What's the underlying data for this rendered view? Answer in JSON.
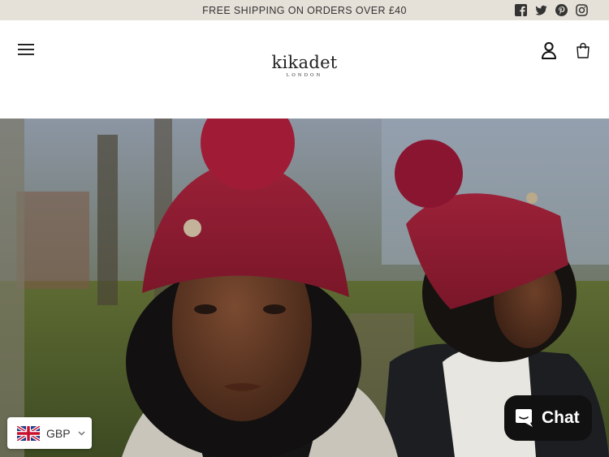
{
  "announcement": {
    "text": "FREE SHIPPING ON ORDERS OVER £40"
  },
  "socials": [
    {
      "icon": "facebook-icon"
    },
    {
      "icon": "twitter-icon"
    },
    {
      "icon": "pinterest-icon"
    },
    {
      "icon": "instagram-icon"
    }
  ],
  "header": {
    "logo_word": "kikadet",
    "logo_sub": "LONDON",
    "menu_icon": "hamburger-menu-icon",
    "account_icon": "user-icon",
    "cart_icon": "shopping-bag-icon"
  },
  "currency": {
    "code": "GBP",
    "flag_icon": "uk-flag-icon"
  },
  "chat": {
    "label": "Chat",
    "icon": "chat-bubble-icon",
    "background": "#111111"
  },
  "colors": {
    "announcement_bg": "#e6e1d8",
    "hat_burgundy": "#8a1c34"
  }
}
